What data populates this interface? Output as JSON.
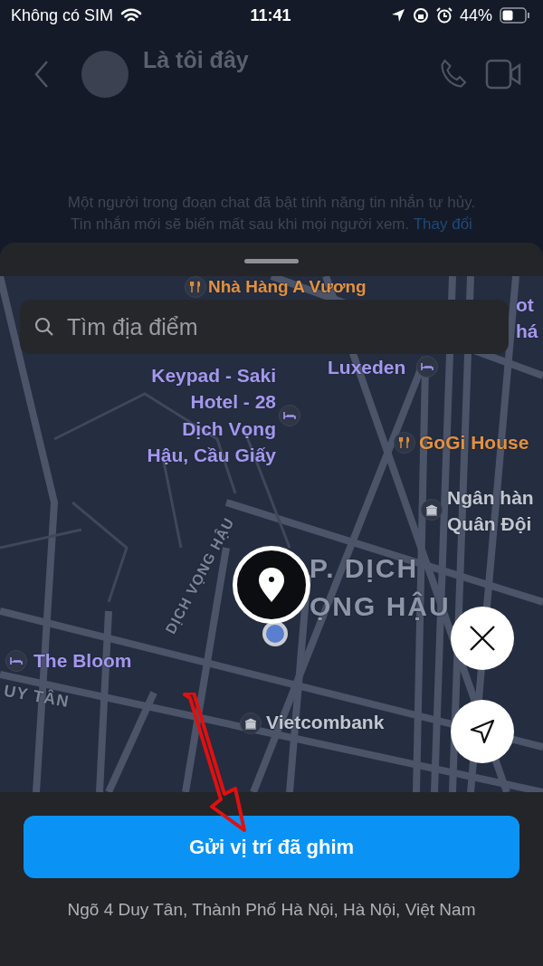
{
  "status_bar": {
    "carrier": "Không có SIM",
    "time": "11:41",
    "battery": "44%"
  },
  "chat_header": {
    "name": "Là tôi đây",
    "notice": "Một người trong đoạn chat đã bật tính năng tin nhắn tự hủy. Tin nhắn mới sẽ biến mất sau khi mọi người xem.",
    "notice_link": "Thay đổi"
  },
  "search": {
    "placeholder": "Tìm địa điểm"
  },
  "map": {
    "places": [
      {
        "kind": "restaurant",
        "lines": [
          "Nhà Hàng A Vương"
        ]
      },
      {
        "kind": "hotel",
        "lines": [
          "ot",
          "há"
        ]
      },
      {
        "kind": "hotel",
        "lines": [
          "Keypad - Saki",
          "Hotel - 28",
          "Dịch Vọng",
          "Hậu, Cầu Giấy"
        ]
      },
      {
        "kind": "hotel",
        "lines": [
          "Luxeden"
        ]
      },
      {
        "kind": "restaurant",
        "lines": [
          "GoGi House"
        ]
      },
      {
        "kind": "bank",
        "lines": [
          "Ngân hàn",
          "Quân Đội"
        ]
      },
      {
        "kind": "district",
        "lines": [
          "P. DỊCH",
          "ỌNG HẬU"
        ]
      },
      {
        "kind": "street",
        "lines": [
          "DỊCH VỌNG HẬU"
        ]
      },
      {
        "kind": "hotel",
        "lines": [
          "The Bloom"
        ]
      },
      {
        "kind": "street",
        "lines": [
          "UY TÂN"
        ]
      },
      {
        "kind": "bank",
        "lines": [
          "Vietcombank"
        ]
      }
    ]
  },
  "send_button": "Gửi vị trí đã ghim",
  "address": "Ngõ 4 Duy Tân, Thành Phố Hà Nội, Hà Nội, Việt Nam"
}
